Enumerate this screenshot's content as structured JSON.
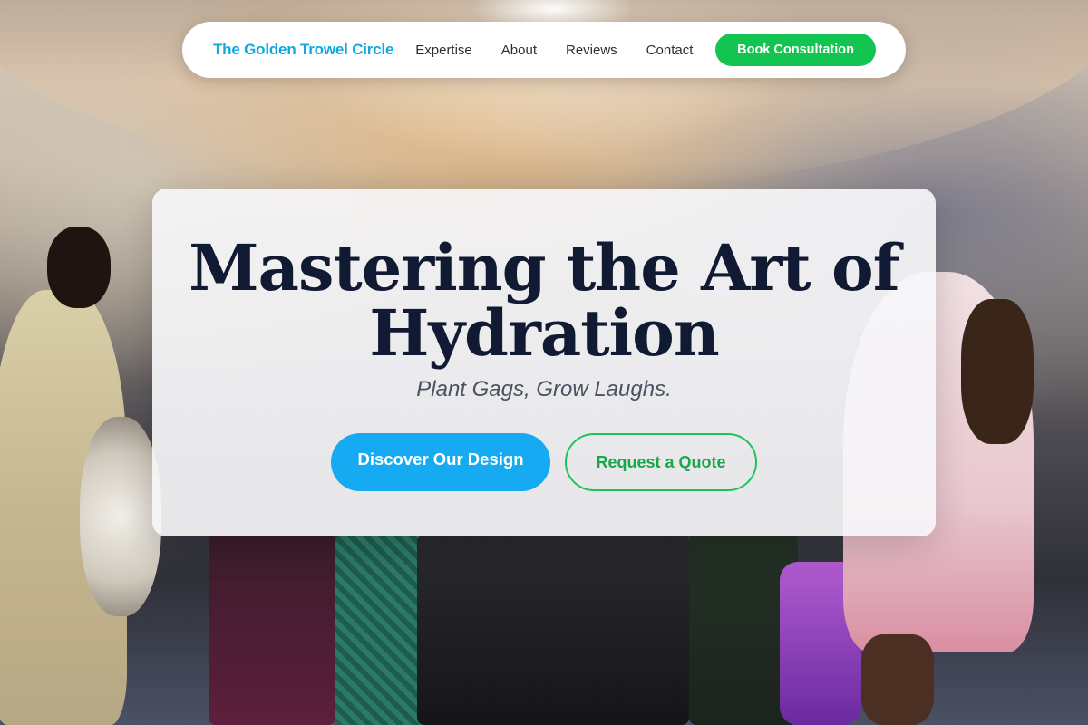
{
  "nav": {
    "brand": "The Golden Trowel Circle",
    "links": [
      "Expertise",
      "About",
      "Reviews",
      "Contact"
    ],
    "cta": "Book Consultation"
  },
  "hero": {
    "title": "Mastering the Art of Hydration",
    "subtitle": "Plant Gags, Grow Laughs.",
    "primary_button": "Discover Our Design",
    "secondary_button": "Request a Quote"
  },
  "colors": {
    "brand": "#12a8de",
    "cta_green": "#14c451",
    "primary_blue": "#16aaf2",
    "title_navy": "#111a33"
  }
}
